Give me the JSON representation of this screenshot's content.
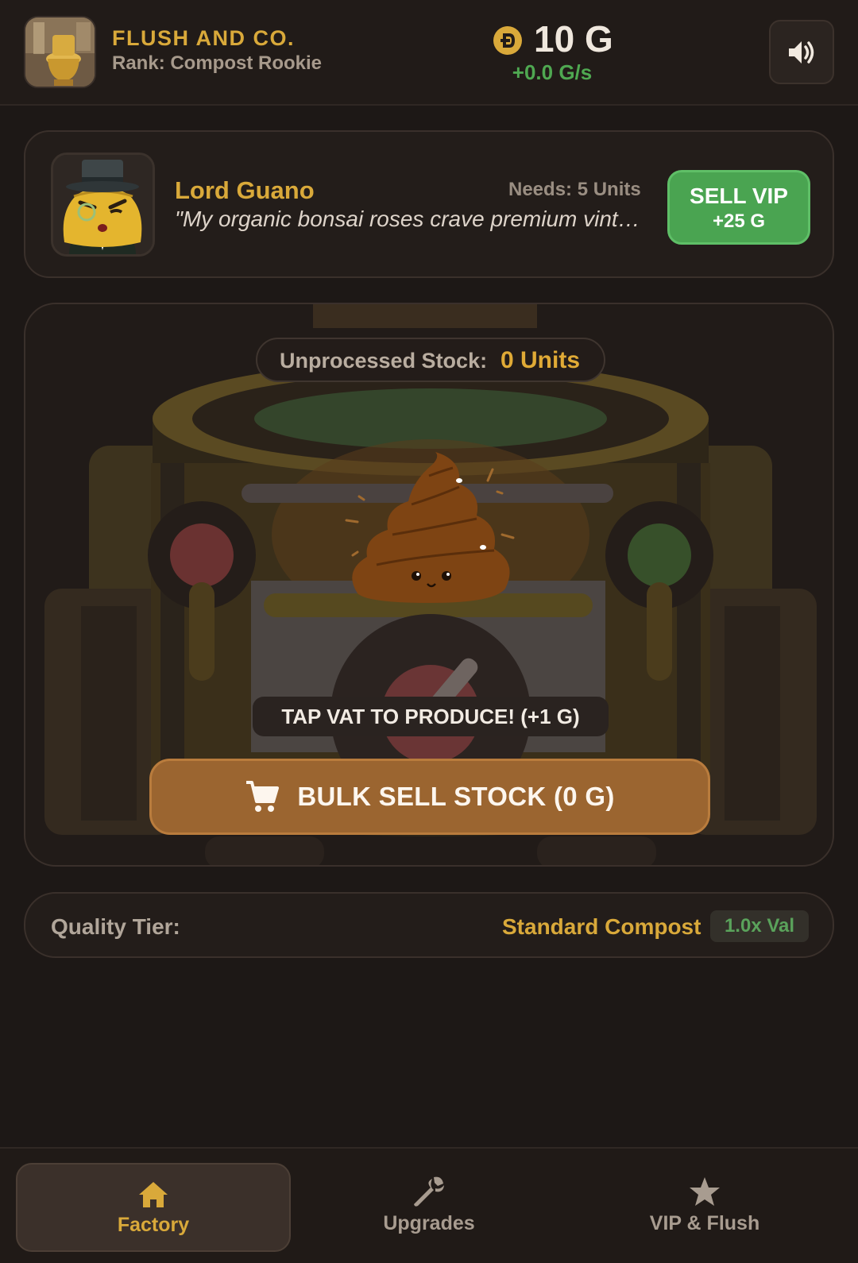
{
  "header": {
    "brand_name": "FLUSH AND CO.",
    "rank": "Rank: Compost Rookie",
    "gold": "10 G",
    "gold_rate": "+0.0 G/s",
    "coin_icon": "coin-icon",
    "sound_icon": "speaker-icon"
  },
  "vip": {
    "name": "Lord Guano",
    "needs": "Needs: 5 Units",
    "quote": "\"My organic bonsai roses crave premium vintage fertilizer!\"",
    "sell_label": "SELL VIP",
    "sell_reward": "+25 G"
  },
  "factory": {
    "stock_label": "Unprocessed Stock:",
    "stock_value": "0 Units",
    "tap_hint": "TAP VAT TO PRODUCE! (+1 G)",
    "bulk_sell_label": "BULK SELL STOCK (0 G)"
  },
  "quality": {
    "label": "Quality Tier:",
    "value": "Standard Compost",
    "multiplier": "1.0x Val"
  },
  "nav": {
    "items": [
      {
        "label": "Factory",
        "icon": "home-icon",
        "active": true
      },
      {
        "label": "Upgrades",
        "icon": "wrench-icon",
        "active": false
      },
      {
        "label": "VIP & Flush",
        "icon": "star-icon",
        "active": false
      }
    ]
  },
  "colors": {
    "accent_gold": "#d9a93a",
    "positive_green": "#4fa851",
    "sell_button": "#9b6530",
    "background": "#1d1816"
  }
}
